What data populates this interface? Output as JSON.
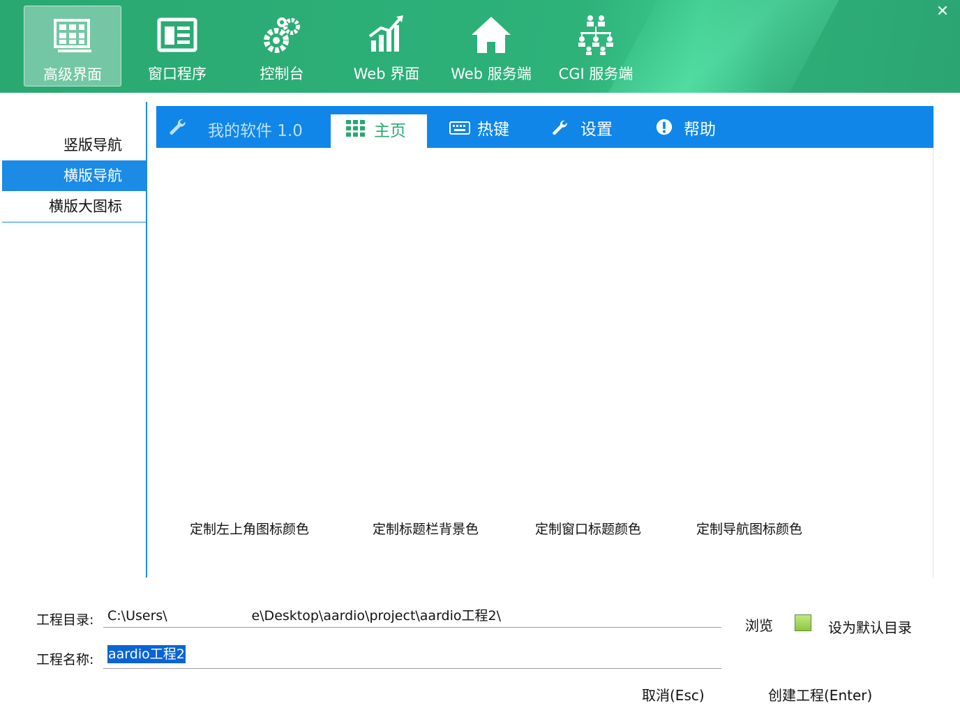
{
  "window": {
    "close_label": "✕"
  },
  "top_nav": {
    "items": [
      {
        "label": "高级界面",
        "icon": "grid-window-icon",
        "active": true
      },
      {
        "label": "窗口程序",
        "icon": "window-form-icon"
      },
      {
        "label": "控制台",
        "icon": "gears-icon"
      },
      {
        "label": "Web 界面",
        "icon": "growth-chart-icon"
      },
      {
        "label": "Web 服务端",
        "icon": "home-icon"
      },
      {
        "label": "CGI 服务端",
        "icon": "org-chart-icon"
      }
    ]
  },
  "side_nav": {
    "items": [
      {
        "label": "竖版导航"
      },
      {
        "label": "横版导航",
        "active": true
      },
      {
        "label": "横版大图标"
      }
    ]
  },
  "preview": {
    "app_title": "我的软件 1.0",
    "tabs": [
      {
        "label": "主页",
        "icon": "apps-grid-icon",
        "active": true
      },
      {
        "label": "热键",
        "icon": "keyboard-icon"
      },
      {
        "label": "设置",
        "icon": "wrench-icon"
      },
      {
        "label": "帮助",
        "icon": "exclamation-icon"
      }
    ],
    "custom_links": [
      "定制左上角图标颜色",
      "定制标题栏背景色",
      "定制窗口标题颜色",
      "定制导航图标颜色"
    ]
  },
  "form": {
    "dir_label": "工程目录:",
    "dir_value": "C:\\Users\\                    e\\Desktop\\aardio\\project\\aardio工程2\\",
    "name_label": "工程名称:",
    "name_value": "aardio工程2",
    "browse_label": "浏览",
    "default_dir_label": "设为默认目录"
  },
  "actions": {
    "cancel_label": "取消(Esc)",
    "create_label": "创建工程(Enter)"
  },
  "colors": {
    "topbar_green": "#2db27a",
    "accent_blue": "#1086e8",
    "active_tab_text": "#2aa872"
  }
}
